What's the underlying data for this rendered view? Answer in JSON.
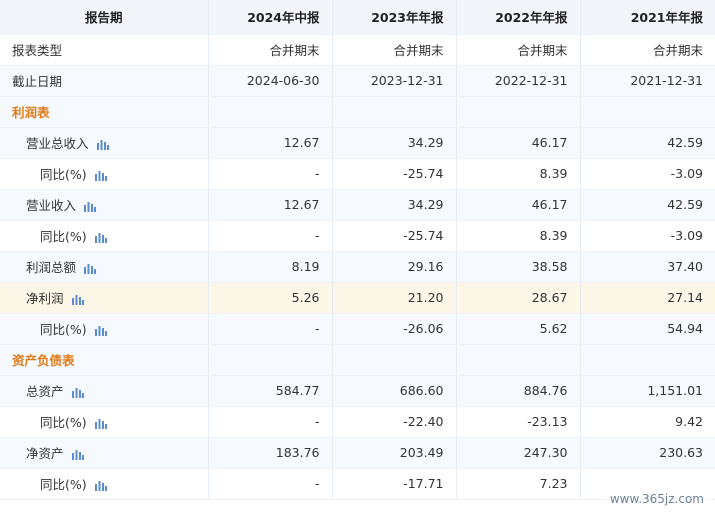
{
  "header": {
    "period_label": "报告期",
    "columns": [
      "2024年中报",
      "2023年年报",
      "2022年年报",
      "2021年年报"
    ]
  },
  "rows": {
    "report_type": {
      "label": "报表类型",
      "values": [
        "合并期末",
        "合并期末",
        "合并期末",
        "合并期末"
      ]
    },
    "end_date": {
      "label": "截止日期",
      "values": [
        "2024-06-30",
        "2023-12-31",
        "2022-12-31",
        "2021-12-31"
      ]
    },
    "section_income": {
      "label": "利润表"
    },
    "total_revenue": {
      "label": "营业总收入",
      "values": [
        "12.67",
        "34.29",
        "46.17",
        "42.59"
      ]
    },
    "total_revenue_yoy": {
      "label": "同比(%)",
      "values": [
        "-",
        "-25.74",
        "8.39",
        "-3.09"
      ]
    },
    "revenue": {
      "label": "营业收入",
      "values": [
        "12.67",
        "34.29",
        "46.17",
        "42.59"
      ]
    },
    "revenue_yoy": {
      "label": "同比(%)",
      "values": [
        "-",
        "-25.74",
        "8.39",
        "-3.09"
      ]
    },
    "total_profit": {
      "label": "利润总额",
      "values": [
        "8.19",
        "29.16",
        "38.58",
        "37.40"
      ]
    },
    "net_profit": {
      "label": "净利润",
      "values": [
        "5.26",
        "21.20",
        "28.67",
        "27.14"
      ]
    },
    "net_profit_yoy": {
      "label": "同比(%)",
      "values": [
        "-",
        "-26.06",
        "5.62",
        "54.94"
      ]
    },
    "section_balance": {
      "label": "资产负债表"
    },
    "total_assets": {
      "label": "总资产",
      "values": [
        "584.77",
        "686.60",
        "884.76",
        "1,151.01"
      ]
    },
    "total_assets_yoy": {
      "label": "同比(%)",
      "values": [
        "-",
        "-22.40",
        "-23.13",
        "9.42"
      ]
    },
    "net_assets": {
      "label": "净资产",
      "values": [
        "183.76",
        "203.49",
        "247.30",
        "230.63"
      ]
    },
    "net_assets_yoy": {
      "label": "同比(%)",
      "values": [
        "-",
        "-17.71",
        "7.23",
        ""
      ]
    }
  },
  "icons": {
    "chart": "bar-chart-icon"
  },
  "colors": {
    "section": "#e07b1a",
    "header_bg": "#f2f6fb",
    "highlight_bg": "#fdf7e7",
    "icon": "#5b8bd0"
  },
  "watermark": "www.365jz.com"
}
